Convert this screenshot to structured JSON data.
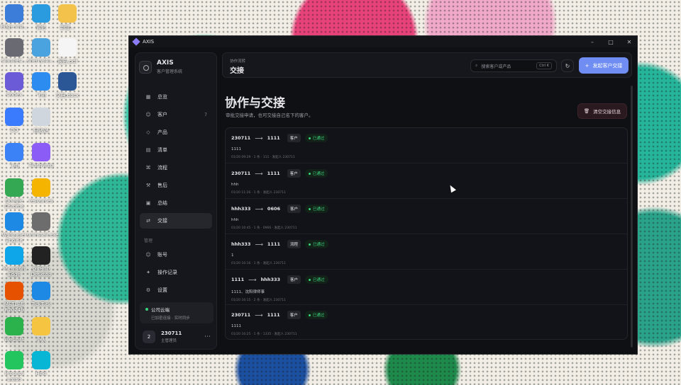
{
  "desktop": {
    "icons": [
      {
        "label": "Edge Ind..."
      },
      {
        "label": "微信"
      },
      {
        "label": "新建..."
      },
      {
        "label": "ClaudeC..."
      },
      {
        "label": "cherrystu..."
      },
      {
        "label": "报告.pdf"
      },
      {
        "label": "Codex"
      },
      {
        "label": "飞书"
      },
      {
        "label": "文档.docx"
      },
      {
        "label": "QQ"
      },
      {
        "label": "回收站"
      },
      {
        "label": "飞书"
      },
      {
        "label": "FlashVerg"
      },
      {
        "label": "Google Chrome"
      },
      {
        "label": "resources"
      },
      {
        "label": "Wallpaper Engine"
      },
      {
        "label": "uninstall.exe"
      },
      {
        "label": "Microsoft Edge"
      },
      {
        "label": "GitHub Desktop"
      },
      {
        "label": "MATLAB R2024b"
      },
      {
        "label": "TickTick"
      },
      {
        "label": "WeChat"
      },
      {
        "label": "个人"
      },
      {
        "label": "Process Lasso"
      },
      {
        "label": "Hoki"
      }
    ]
  },
  "window": {
    "title": "AXIS"
  },
  "brand": {
    "name": "AXIS",
    "subtitle": "客户管理系统"
  },
  "nav": [
    {
      "icon": "▦",
      "label": "总览",
      "badge": ""
    },
    {
      "icon": "☺",
      "label": "客户",
      "badge": "7"
    },
    {
      "icon": "◇",
      "label": "产品",
      "badge": ""
    },
    {
      "icon": "▤",
      "label": "清单",
      "badge": ""
    },
    {
      "icon": "⌘",
      "label": "流程",
      "badge": ""
    },
    {
      "icon": "⚒",
      "label": "售后",
      "badge": ""
    },
    {
      "icon": "▣",
      "label": "总结",
      "badge": ""
    },
    {
      "icon": "⇄",
      "label": "交接",
      "badge": ""
    }
  ],
  "nav_section": "管理",
  "nav2": [
    {
      "icon": "☺",
      "label": "账号"
    },
    {
      "icon": "✦",
      "label": "操作记录"
    },
    {
      "icon": "⚙",
      "label": "设置"
    }
  ],
  "cloud": {
    "title": "公司云端",
    "status": "已加密连接 · 实时同步"
  },
  "user": {
    "avatar": "2",
    "name": "230711",
    "role": "主管理员"
  },
  "topbar": {
    "breadcrumb": "协作流转",
    "title": "交接",
    "search_placeholder": "搜索客户或产品",
    "kbd": "Ctrl K",
    "primary_label": "发起客户交接"
  },
  "page": {
    "title": "协作与交接",
    "subtitle": "审批交接申请，也可交接自己名下的客户。",
    "clear_label": "清空交接信息"
  },
  "handoffs": [
    {
      "from": "230711",
      "to": "1111",
      "tag": "客户",
      "status": "已通过",
      "note": "1111",
      "meta": "01/20 09:29 · 1 条 · 111 · 发起人 230711"
    },
    {
      "from": "230711",
      "to": "1111",
      "tag": "客户",
      "status": "已通过",
      "note": "hhh",
      "meta": "01/20 11:26 · 1 条 · 发起人 230711"
    },
    {
      "from": "hhh333",
      "to": "0606",
      "tag": "客户",
      "status": "已通过",
      "note": "hhh",
      "meta": "01/20 16:45 · 1 条 · 0966 · 发起人 230711"
    },
    {
      "from": "hhh333",
      "to": "1111",
      "tag": "流程",
      "status": "已通过",
      "note": "1",
      "meta": "01/20 16:16 · 1 条 · 发起人 230711"
    },
    {
      "from": "1111",
      "to": "hhh333",
      "tag": "客户",
      "status": "已通过",
      "note": "1111、沈阳律师事",
      "meta": "01/20 16:15 · 2 条 · 发起人 230711"
    },
    {
      "from": "230711",
      "to": "1111",
      "tag": "客户",
      "status": "已通过",
      "note": "1111",
      "meta": "01/20 16:25 · 1 条 · 1335 · 发起人 230711"
    }
  ],
  "colors": {
    "accent": "#6f8df2",
    "success": "#3ad47d",
    "danger_bg": "#2a1a1f"
  }
}
